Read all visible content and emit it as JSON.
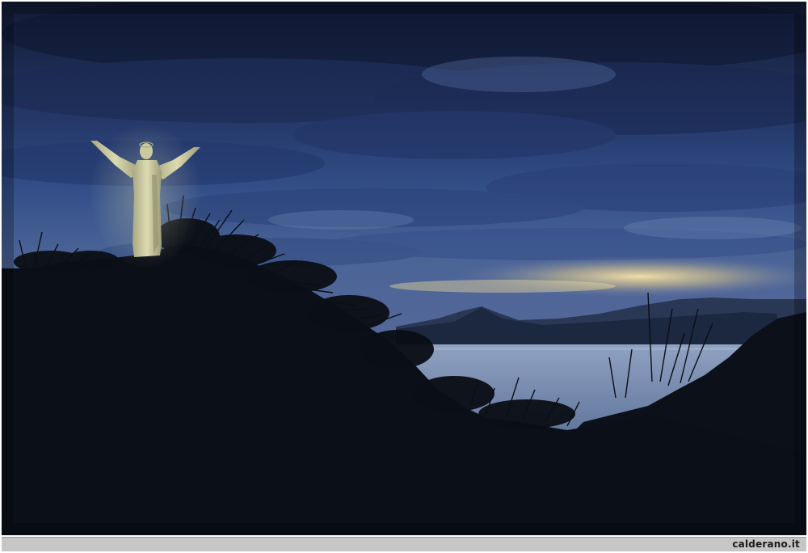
{
  "photo": {
    "subject": "statue-at-dusk-over-bay",
    "colors": {
      "sky_top": "#16213f",
      "sky_mid": "#2c4276",
      "sky_low": "#3d5a93",
      "glow": "#f2d794",
      "water": "#7f93b6",
      "mountains": "#1f2a40",
      "foreground": "#0b0f17",
      "statue": "#c9c7a0"
    }
  },
  "footer": {
    "credit": "calderano.it"
  }
}
